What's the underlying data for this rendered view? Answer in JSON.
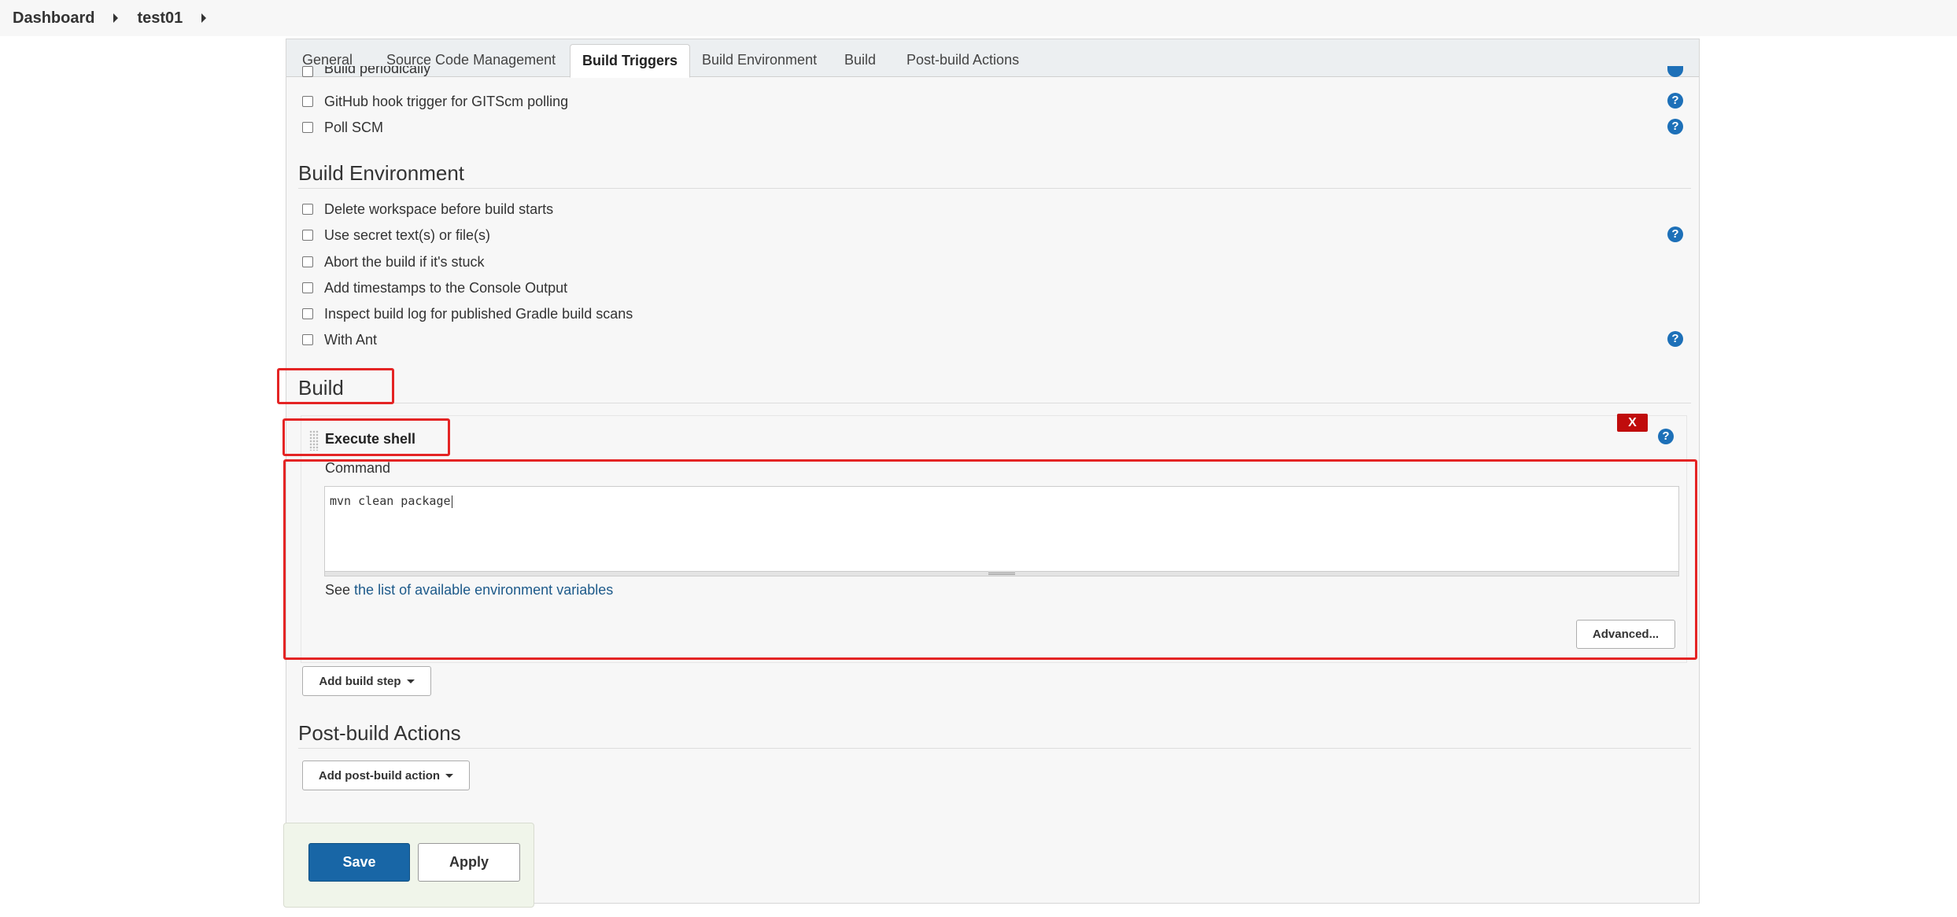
{
  "breadcrumb": {
    "items": [
      "Dashboard",
      "test01"
    ]
  },
  "tabs": [
    "General",
    "Source Code Management",
    "Build Triggers",
    "Build Environment",
    "Build",
    "Post-build Actions"
  ],
  "active_tab": "Build Triggers",
  "build_triggers": {
    "partial_item": "Build periodically",
    "items": [
      "GitHub hook trigger for GITScm polling",
      "Poll SCM"
    ]
  },
  "build_environment": {
    "title": "Build Environment",
    "items": [
      "Delete workspace before build starts",
      "Use secret text(s) or file(s)",
      "Abort the build if it's stuck",
      "Add timestamps to the Console Output",
      "Inspect build log for published Gradle build scans",
      "With Ant"
    ]
  },
  "build": {
    "title": "Build",
    "step_title": "Execute shell",
    "delete_label": "X",
    "command_label": "Command",
    "command_value": "mvn clean package",
    "see_prefix": "See",
    "see_link": "the list of available environment variables",
    "advanced_label": "Advanced...",
    "add_step_label": "Add build step"
  },
  "post_build": {
    "title": "Post-build Actions",
    "add_action_label": "Add post-build action"
  },
  "actions": {
    "save": "Save",
    "apply": "Apply"
  },
  "help_icon": "?",
  "colors": {
    "accent": "#1866a6",
    "help": "#1d70b8",
    "link": "#1d5a8a",
    "highlight": "#e42424",
    "delete": "#c00c0c"
  }
}
